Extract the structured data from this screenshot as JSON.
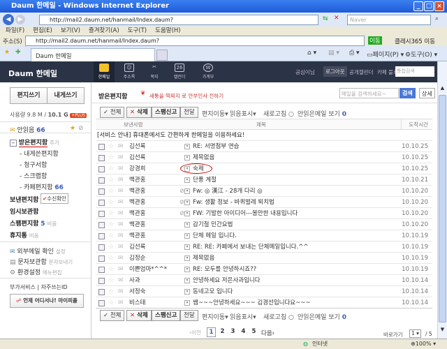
{
  "window": {
    "title": "Daum 한메일 - Windows Internet Explorer"
  },
  "browser": {
    "url": "http://mail2.daum.net/hanmail/Index.daum?",
    "search_placeholder": "Naver",
    "menu": [
      "파일(F)",
      "편집(E)",
      "보기(V)",
      "즐겨찾기(A)",
      "도구(T)",
      "도움말(H)"
    ],
    "address_label": "주소(S)",
    "go_label": "이동",
    "addon_label": "클레시365 이동",
    "tab_title": "Daum 한메일",
    "page_label": "페이지(P)",
    "tools_label": "도구(O)"
  },
  "header": {
    "logo": "Daum 한메일",
    "nav": [
      "한메일",
      "주소록",
      "쪽지",
      "캘린더",
      "가계부"
    ],
    "calendar_day": "26",
    "links": [
      "공심이님",
      "로그아웃",
      "공개캘린더",
      "카페",
      "블로그"
    ],
    "search_placeholder": "통합검색"
  },
  "sidebar": {
    "compose": "편지쓰기",
    "self": "내게쓰기",
    "usage": "사용량 9.8 M / ",
    "quota": "10.1 G",
    "plus": "+PLUS",
    "unread_label": "안읽음",
    "unread_count": "66",
    "inbox": "받은편지함",
    "inbox_add": "추가",
    "subfolders": [
      {
        "label": "내게쓴편지함"
      },
      {
        "label": "청구서함"
      },
      {
        "label": "스크랩함"
      },
      {
        "label": "카페편지함",
        "count": "66"
      }
    ],
    "sent": "보낸편지함",
    "receipt": "수신확인",
    "drafts": "임시보관함",
    "spam": "스팸편지함",
    "spam_count": "5",
    "spam_empty": "비움",
    "trash": "휴지통",
    "trash_empty": "비움",
    "ext_mail": "외부메일 확인",
    "ext_setting": "설정",
    "sms": "문자보관함",
    "sms_send": "문자보내기",
    "settings": "환경설정",
    "menu_edit": "메뉴편집",
    "addon": "부가서비스",
    "favid": "자주쓰는ID",
    "banner": "언제 어디서나! 마이피플"
  },
  "main": {
    "title": "받은편지함",
    "promo": "새통을 떡찌지 로 안부인사 전하기",
    "search_placeholder": "메일을 검색하세요~",
    "search_btn": "검색",
    "detail_btn": "상세",
    "toolbar": {
      "all": "전체",
      "delete": "삭제",
      "spam": "스팸신고",
      "forward": "전달",
      "move": "편지이동",
      "mark": "읽음표시",
      "refresh": "새로고침",
      "unread_view": "안읽은메일 보기",
      "unread_count": "0"
    },
    "columns": {
      "sender": "보낸사람",
      "subject": "제목",
      "date": "도착시간"
    },
    "notice": "[서비스 안내] 휴대폰에서도 간편하게 한메일을 이용하세요!",
    "rows": [
      {
        "sender": "김선록",
        "subject": "RE: 서명첨부 연습",
        "date": "10.10.25",
        "clip": false
      },
      {
        "sender": "김선록",
        "subject": "제목없음",
        "date": "10.10.25",
        "clip": false
      },
      {
        "sender": "강경희",
        "subject": "숙제",
        "date": "10.10.25",
        "clip": false
      },
      {
        "sender": "백관홍",
        "subject": "단풍 계절",
        "date": "10.10.21",
        "clip": false
      },
      {
        "sender": "백관홍",
        "subject": "Fw: ◎ 漢江 - 28개 다리 ◎",
        "date": "10.10.20",
        "clip": true
      },
      {
        "sender": "백관홍",
        "subject": "Fw: 생활 정보 - 바퀴벌레 퇴치법",
        "date": "10.10.20",
        "clip": true
      },
      {
        "sender": "백관홍",
        "subject": "FW: 기발한 아이디어---볼만한 내용입니다",
        "date": "10.10.20",
        "clip": true
      },
      {
        "sender": "백관홍",
        "subject": "감기철 민간요법",
        "date": "10.10.20",
        "clip": false
      },
      {
        "sender": "백관홍",
        "subject": "단체 메일 입니다.",
        "date": "10.10.19",
        "clip": false
      },
      {
        "sender": "김선록",
        "subject": "RE: RE: 카페에서 보내는 단체메일입니다.^^",
        "date": "10.10.19",
        "clip": false
      },
      {
        "sender": "김정순",
        "subject": "제목없음",
        "date": "10.10.19",
        "clip": false
      },
      {
        "sender": "이쁜엄마*^^*",
        "subject": "RE: 모두를 안녕하시죠??",
        "date": "10.10.19",
        "clip": false
      },
      {
        "sender": "사과",
        "subject": "안녕하세요 저은사과입니다",
        "date": "10.10.14",
        "clip": false
      },
      {
        "sender": "서정숙",
        "subject": "동네고모 입니다",
        "date": "10.10.14",
        "clip": false
      },
      {
        "sender": "비스태",
        "subject": "쌤~~~안녕하세요~~~ 김경선입니다요~~~",
        "date": "10.10.14",
        "clip": false
      }
    ],
    "pagination": {
      "prev": "이전",
      "pages": [
        "1",
        "2",
        "3",
        "4",
        "5"
      ],
      "next": "다음",
      "goto": "바로가기",
      "current": "1",
      "total": "/ 5"
    }
  },
  "status": {
    "zone": "인터넷",
    "zoom": "100%"
  }
}
